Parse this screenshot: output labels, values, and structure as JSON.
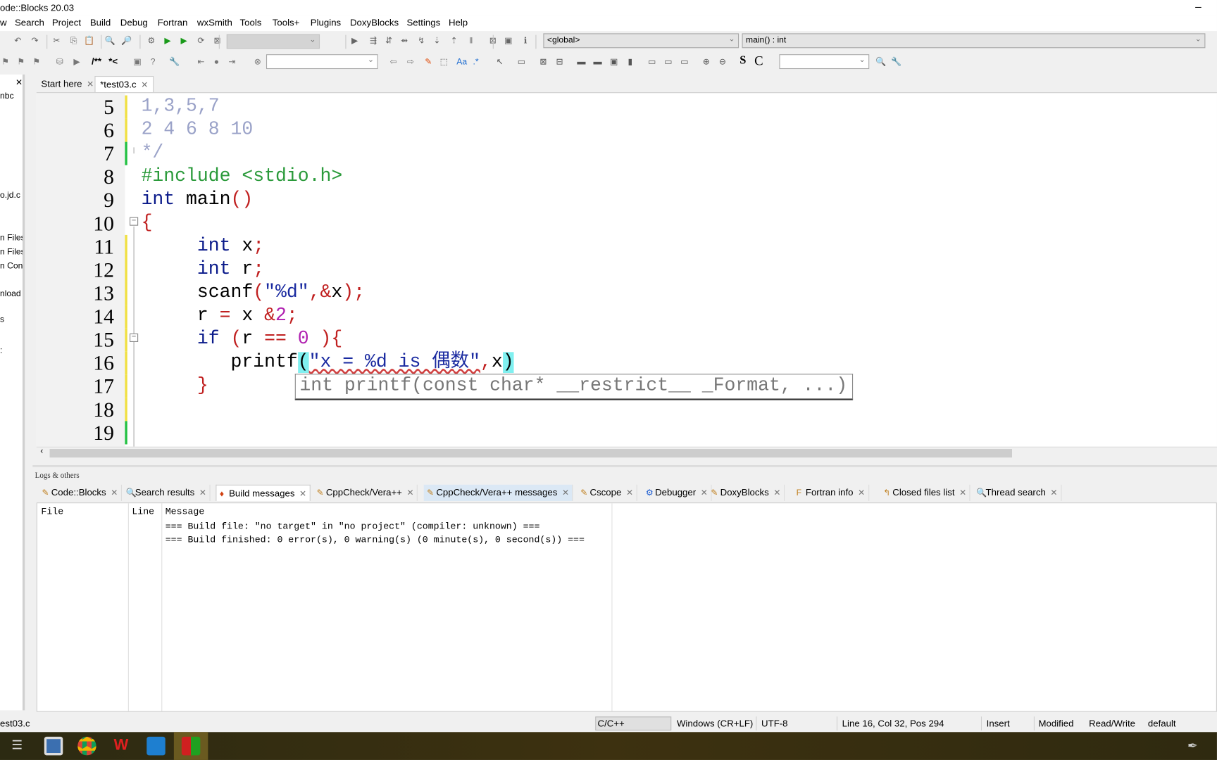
{
  "window": {
    "title": "ode::Blocks 20.03",
    "minimize": "–"
  },
  "menu": [
    "w",
    "Search",
    "Project",
    "Build",
    "Debug",
    "Fortran",
    "wxSmith",
    "Tools",
    "Tools+",
    "Plugins",
    "DoxyBlocks",
    "Settings",
    "Help"
  ],
  "toolbar": {
    "scope_combo": "<global>",
    "function_combo": "main() : int",
    "icons1": [
      "open-icon",
      "undo-icon",
      "redo-icon",
      "cut-icon",
      "copy-icon",
      "paste-icon",
      "find-icon",
      "replace-icon",
      "build-icon",
      "run-icon",
      "build-run-icon",
      "rebuild-icon",
      "abort-icon",
      "debug-run-icon",
      "step-icon",
      "step-into-icon",
      "step-out-icon",
      "next-instr-icon",
      "step-instr-icon",
      "stop-icon",
      "abort-debug-icon",
      "debug-window-icon",
      "info-icon"
    ],
    "icons2": [
      "bookmark-prev-icon",
      "bookmark-next-icon",
      "bookmark-clear-icon",
      "doxy-icon",
      "doxy-run-icon",
      "comment-icon",
      "config-icon",
      "jump-back-icon",
      "jump-dot-icon",
      "jump-fwd-icon",
      "highlight-icon",
      "S",
      "C",
      "search-icon",
      "wrench-icon"
    ],
    "text_comment_block": "/**",
    "text_comment_line": "*<",
    "bold_s": "S",
    "bold_c": "C"
  },
  "left_panel": {
    "items": [
      "nbc",
      "o.jd.c",
      "n Files",
      "n Files",
      "n Con",
      "nload",
      "s",
      ":"
    ]
  },
  "editor_tabs": [
    {
      "label": "Start here",
      "active": false
    },
    {
      "label": "*test03.c",
      "active": true
    }
  ],
  "editor": {
    "lines": [
      {
        "num": "5",
        "mark": "#f0e040",
        "tokens": [
          [
            "1,3,5,7",
            "#9aa2c8"
          ]
        ]
      },
      {
        "num": "6",
        "mark": "#f0e040",
        "tokens": [
          [
            "2 4 6 8 10",
            "#9aa2c8"
          ]
        ]
      },
      {
        "num": "7",
        "mark": "#20c040",
        "tokens": [
          [
            "*/",
            "#9aa2c8"
          ]
        ]
      },
      {
        "num": "8",
        "mark": "",
        "tokens": [
          [
            "#include <stdio.h>",
            "#2a9a3a"
          ]
        ]
      },
      {
        "num": "9",
        "mark": "",
        "tokens": [
          [
            "int",
            "#0a1a8a"
          ],
          [
            " main",
            ""
          ],
          [
            "()",
            "#c02020"
          ]
        ]
      },
      {
        "num": "10",
        "mark": "",
        "tokens": [
          [
            "{",
            "#c02020"
          ]
        ]
      },
      {
        "num": "11",
        "mark": "#f0e040",
        "tokens": [
          [
            "     int",
            "#0a1a8a"
          ],
          [
            " x",
            ""
          ],
          [
            ";",
            "#c02020"
          ]
        ]
      },
      {
        "num": "12",
        "mark": "#f0e040",
        "tokens": [
          [
            "     int",
            "#0a1a8a"
          ],
          [
            " r",
            ""
          ],
          [
            ";",
            "#c02020"
          ]
        ]
      },
      {
        "num": "13",
        "mark": "#f0e040",
        "tokens": [
          [
            "     scanf",
            ""
          ],
          [
            "(",
            "#c02020"
          ],
          [
            "\"%d\"",
            "#1a2aa0"
          ],
          [
            ",&",
            "#c02020"
          ],
          [
            "x",
            ""
          ],
          [
            ");",
            "#c02020"
          ]
        ]
      },
      {
        "num": "14",
        "mark": "#f0e040",
        "tokens": [
          [
            "     r ",
            ""
          ],
          [
            "=",
            "#c02020"
          ],
          [
            " x ",
            ""
          ],
          [
            "&",
            "#c02020"
          ],
          [
            "2",
            "#b020b0"
          ],
          [
            ";",
            "#c02020"
          ]
        ]
      },
      {
        "num": "15",
        "mark": "#f0e040",
        "tokens": [
          [
            "     if",
            "#0a1a8a"
          ],
          [
            " (",
            "#c02020"
          ],
          [
            "r ",
            ""
          ],
          [
            "==",
            "#c02020"
          ],
          [
            " ",
            ""
          ],
          [
            "0",
            "#b020b0"
          ],
          [
            " ){",
            "#c02020"
          ]
        ]
      },
      {
        "num": "16",
        "mark": "#f0e040",
        "tokens": [
          [
            "        printf",
            ""
          ],
          [
            "(",
            "#000",
            "#80f0f0"
          ],
          [
            "\"x = %d is 偶数\"",
            "#1a2aa0"
          ],
          [
            ",",
            "#c02020"
          ],
          [
            "x",
            ""
          ],
          [
            ")",
            "#000",
            "#80f0f0"
          ]
        ]
      },
      {
        "num": "17",
        "mark": "#f0e040",
        "tokens": [
          [
            "     }",
            "#c02020"
          ]
        ]
      },
      {
        "num": "18",
        "mark": "#f0e040",
        "tokens": [
          [
            "",
            ""
          ]
        ]
      },
      {
        "num": "19",
        "mark": "#20c040",
        "tokens": [
          [
            "",
            ""
          ]
        ]
      }
    ],
    "calltip": "int printf(const char* __restrict__ _Format, ...)"
  },
  "logs": {
    "title": "Logs & others",
    "tabs": [
      {
        "label": "Code::Blocks",
        "icon": "✎"
      },
      {
        "label": "Search results",
        "icon": "🔍"
      },
      {
        "label": "Build messages",
        "icon": "♦",
        "active": true
      },
      {
        "label": "CppCheck/Vera++",
        "icon": "✎"
      },
      {
        "label": "CppCheck/Vera++ messages",
        "icon": "✎",
        "hl": true
      },
      {
        "label": "Cscope",
        "icon": "✎"
      },
      {
        "label": "Debugger",
        "icon": "⚙"
      },
      {
        "label": "DoxyBlocks",
        "icon": "✎"
      },
      {
        "label": "Fortran info",
        "icon": "F"
      },
      {
        "label": "Closed files list",
        "icon": "↰"
      },
      {
        "label": "Thread search",
        "icon": "🔍"
      }
    ],
    "columns": [
      "File",
      "Line",
      "Message"
    ],
    "messages": [
      "=== Build file: \"no target\" in \"no project\" (compiler: unknown) ===",
      "=== Build finished: 0 error(s), 0 warning(s) (0 minute(s), 0 second(s)) ==="
    ]
  },
  "status": {
    "file": "est03.c",
    "lang": "C/C++",
    "eol": "Windows (CR+LF)",
    "enc": "UTF-8",
    "pos": "Line 16, Col 32, Pos 294",
    "mode": "Insert",
    "mod": "Modified",
    "rw": "Read/Write",
    "profile": "default"
  },
  "taskbar": {
    "apps": [
      "task-view-icon",
      "file-explorer-icon",
      "chrome-icon",
      "wps-icon",
      "video-app-icon",
      "codeblocks-icon"
    ]
  }
}
